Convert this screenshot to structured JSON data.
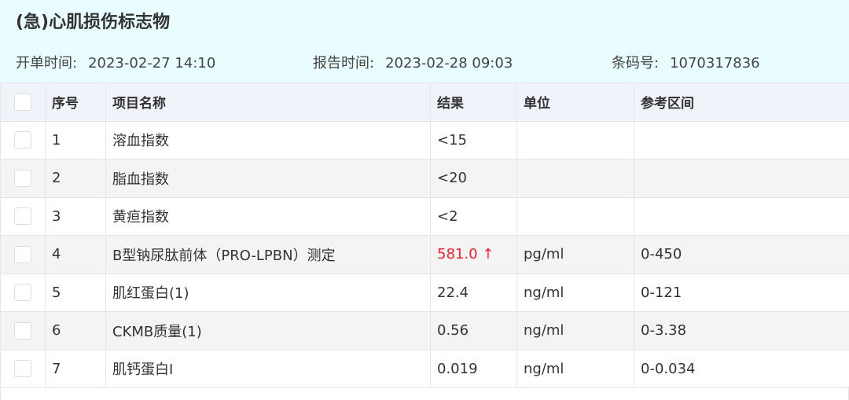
{
  "title": "(急)心肌损伤标志物",
  "meta": {
    "order_time_label": "开单时间:",
    "order_time": "2023-02-27 14:10",
    "report_time_label": "报告时间:",
    "report_time": "2023-02-28 09:03",
    "barcode_label": "条码号:",
    "barcode": "1070317836"
  },
  "table": {
    "headers": {
      "seq": "序号",
      "name": "项目名称",
      "result": "结果",
      "unit": "单位",
      "range": "参考区间"
    },
    "rows": [
      {
        "seq": "1",
        "name": "溶血指数",
        "result": "<15",
        "unit": "",
        "range": ""
      },
      {
        "seq": "2",
        "name": "脂血指数",
        "result": "<20",
        "unit": "",
        "range": ""
      },
      {
        "seq": "3",
        "name": "黄疸指数",
        "result": "<2",
        "unit": "",
        "range": ""
      },
      {
        "seq": "4",
        "name": "B型钠尿肽前体（PRO-LPBN）测定",
        "result": "581.0 ↑",
        "unit": "pg/ml",
        "range": "0-450"
      },
      {
        "seq": "5",
        "name": "肌红蛋白(1)",
        "result": "22.4",
        "unit": "ng/ml",
        "range": "0-121"
      },
      {
        "seq": "6",
        "name": "CKMB质量(1)",
        "result": "0.56",
        "unit": "ng/ml",
        "range": "0-3.38"
      },
      {
        "seq": "7",
        "name": "肌钙蛋白I",
        "result": "0.019",
        "unit": "ng/ml",
        "range": "0-0.034"
      }
    ]
  },
  "colors": {
    "abnormal": "#f5222d",
    "header_bg": "#e9fdfe"
  }
}
